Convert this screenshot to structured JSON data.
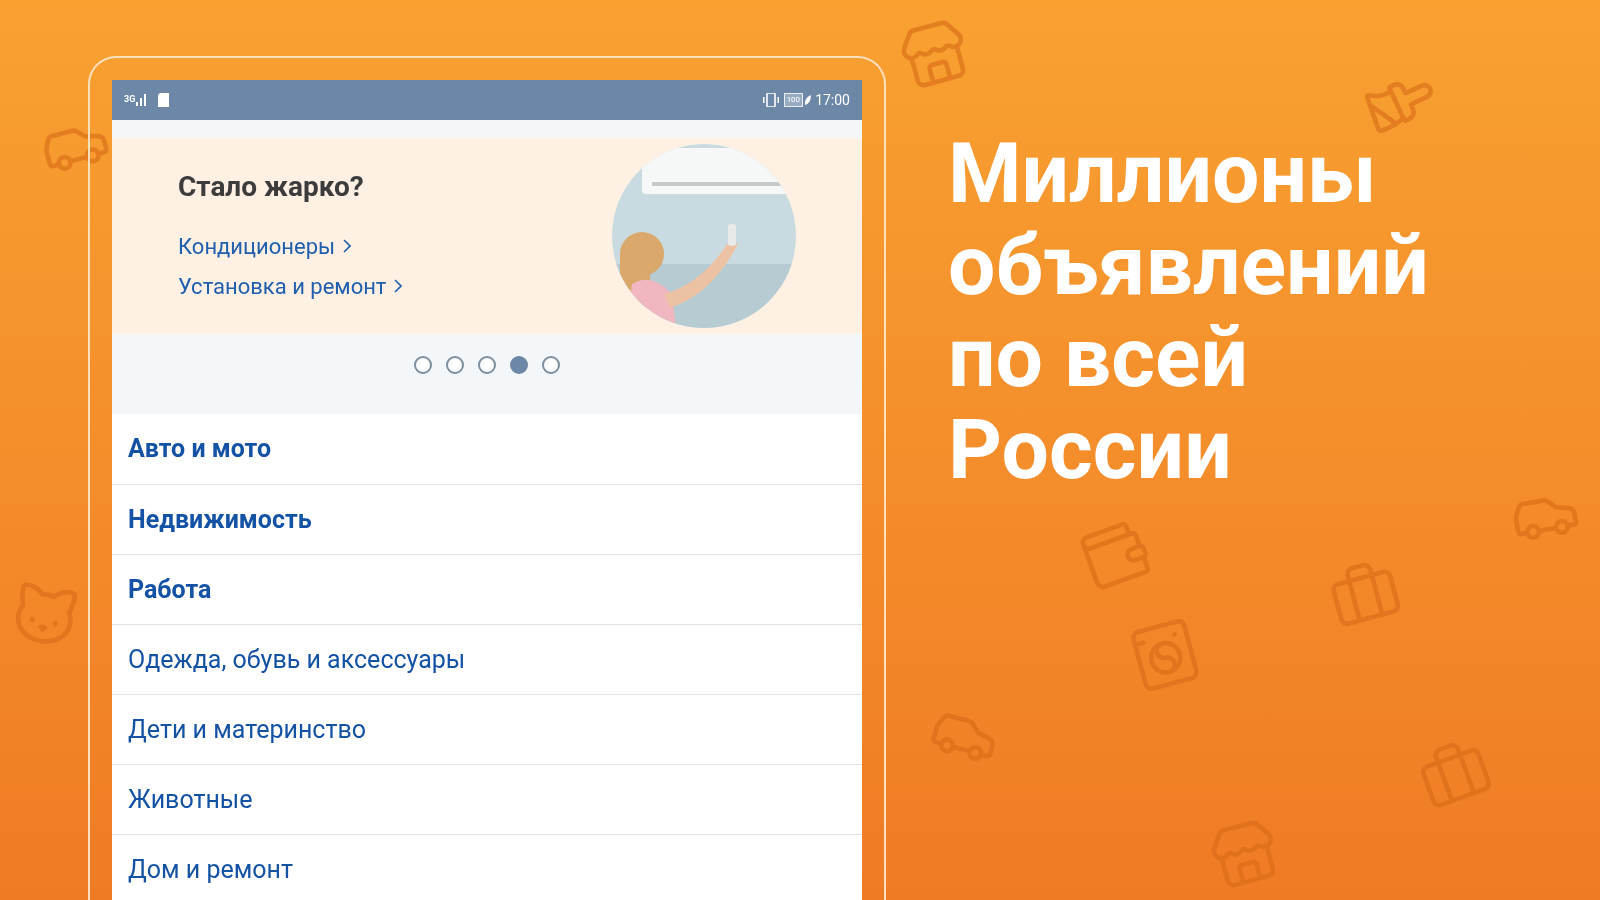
{
  "status_bar": {
    "network": "3G",
    "battery": "100",
    "time": "17:00"
  },
  "banner": {
    "title": "Стало жарко?",
    "links": [
      "Кондиционеры",
      "Установка и ремонт"
    ]
  },
  "carousel_dots": [
    {
      "selected": false
    },
    {
      "selected": false
    },
    {
      "selected": false
    },
    {
      "selected": true
    },
    {
      "selected": false
    }
  ],
  "categories": [
    {
      "label": "Авто и мото",
      "emphasized": true
    },
    {
      "label": "Недвижимость",
      "emphasized": true
    },
    {
      "label": "Работа",
      "emphasized": true
    },
    {
      "label": "Одежда, обувь и аксессуары",
      "emphasized": false
    },
    {
      "label": "Дети и материнство",
      "emphasized": false
    },
    {
      "label": "Животные",
      "emphasized": false
    },
    {
      "label": "Дом и ремонт",
      "emphasized": false
    }
  ],
  "headline": "Миллионы объявлений по всей России"
}
